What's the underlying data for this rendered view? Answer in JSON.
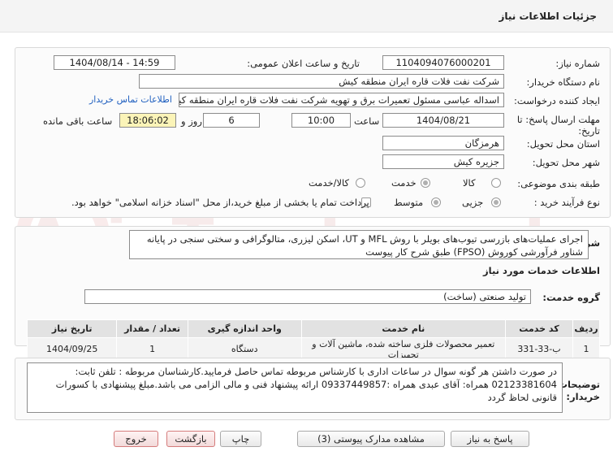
{
  "page_title": "جزئیات اطلاعات نیاز",
  "fields": {
    "need_number_label": "شماره نیاز:",
    "need_number": "1104094076000201",
    "announce_label": "تاریخ و ساعت اعلان عمومی:",
    "announce_value": "1404/08/14 - 14:59",
    "buyer_label": "نام دستگاه خریدار:",
    "buyer_value": "شرکت نفت فلات قاره ایران منطقه کیش",
    "creator_label": "ایجاد کننده درخواست:",
    "creator_value": "اسداله  عباسی  مسئول تعمیرات برق و تهویه  شرکت نفت فلات قاره ایران منطقه کیش",
    "contact_link": "اطلاعات تماس خریدار",
    "deadline_label_1": "مهلت ارسال پاسخ: تا",
    "deadline_label_2": "تاریخ:",
    "deadline_date": "1404/08/21",
    "time_label": "ساعت",
    "deadline_time": "10:00",
    "days_value": "6",
    "days_label": "روز و",
    "remaining_time": "18:06:02",
    "remaining_label": "ساعت باقی مانده",
    "province_label": "استان محل تحویل:",
    "province_value": "هرمزگان",
    "city_label": "شهر محل تحویل:",
    "city_value": "جزیره کیش",
    "category_label": "طبقه بندی موضوعی:",
    "category_options": [
      "کالا",
      "خدمت",
      "کالا/خدمت"
    ],
    "category_selected": "خدمت",
    "process_label": "نوع فرآیند خرید :",
    "process_options": [
      "جزیی",
      "متوسط"
    ],
    "process_selected": "جزیی",
    "payment_note": "پرداخت تمام یا بخشی از مبلغ خرید،از محل \"اسناد خزانه اسلامی\" خواهد بود."
  },
  "description": {
    "label": "شرح کلی نیاز:",
    "text": "اجرای عملیات‌های بازرسی تیوب‌های بویلر با روش MFL و UT، اسکن لیزری، متالوگرافی و سختی سنجی در پایانه شناور فرآورشی کوروش (FPSO)  طبق شرح کار پیوست"
  },
  "services_info_title": "اطلاعات خدمات مورد نیاز",
  "service_group": {
    "label": "گروه خدمت:",
    "value": "تولید صنعتی (ساخت)"
  },
  "table": {
    "headers": [
      "ردیف",
      "کد خدمت",
      "نام خدمت",
      "واحد اندازه گیری",
      "تعداد / مقدار",
      "تاریخ نیاز"
    ],
    "rows": [
      [
        "1",
        "ب-33-331",
        "تعمیر محصولات فلزی ساخته شده، ماشین آلات و تجهیزات",
        "دستگاه",
        "1",
        "1404/09/25"
      ]
    ]
  },
  "buyer_notes": {
    "label_1": "توضیحات",
    "label_2": "خریدار:",
    "text": "در صورت داشتن هر گونه سوال در ساعات اداری با کارشناس مربوطه  تماس حاصل فرمایید.کارشناسان مربوطه :  تلفن ثابت: 02123381604 همراه:   آقای عبدی همراه :09337449857 ارائه پیشنهاد فنی و مالی الزامی می باشد.مبلغ پیشنهادی با کسورات قانونی لحاظ گردد"
  },
  "buttons": {
    "reply": "پاسخ به نیاز",
    "attachments": "مشاهده مدارک پیوستی (3)",
    "print": "چاپ",
    "back": "بازگشت",
    "exit": "خروج"
  },
  "watermark": "AriaTender.net"
}
